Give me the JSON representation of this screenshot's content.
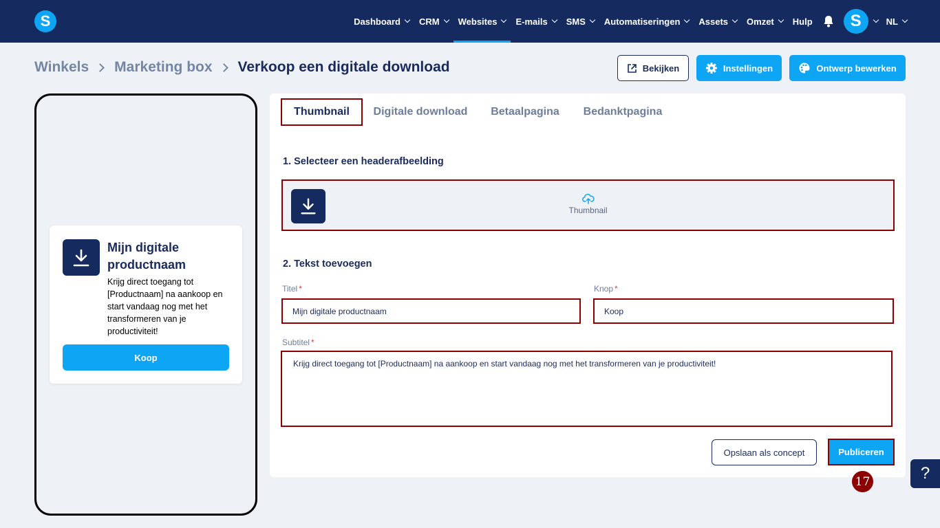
{
  "nav": {
    "logo_letter": "S",
    "items": [
      {
        "label": "Dashboard",
        "dropdown": true,
        "active": false
      },
      {
        "label": "CRM",
        "dropdown": true,
        "active": false
      },
      {
        "label": "Websites",
        "dropdown": true,
        "active": true
      },
      {
        "label": "E-mails",
        "dropdown": true,
        "active": false
      },
      {
        "label": "SMS",
        "dropdown": true,
        "active": false
      },
      {
        "label": "Automatiseringen",
        "dropdown": true,
        "active": false
      },
      {
        "label": "Assets",
        "dropdown": true,
        "active": false
      },
      {
        "label": "Omzet",
        "dropdown": true,
        "active": false
      },
      {
        "label": "Hulp",
        "dropdown": false,
        "active": false
      }
    ],
    "avatar_letter": "S",
    "language": "NL"
  },
  "breadcrumb": {
    "items": [
      "Winkels",
      "Marketing box"
    ],
    "current": "Verkoop een digitale download"
  },
  "header_buttons": {
    "view": "Bekijken",
    "settings": "Instellingen",
    "design": "Ontwerp bewerken"
  },
  "preview": {
    "title": "Mijn digitale productnaam",
    "subtitle": "Krijg direct toegang tot [Productnaam] na aankoop en start vandaag nog met het transformeren van je productiviteit!",
    "button": "Koop"
  },
  "tabs": [
    "Thumbnail",
    "Digitale download",
    "Betaalpagina",
    "Bedanktpagina"
  ],
  "active_tab": "Thumbnail",
  "section1": {
    "title": "1. Selecteer een headerafbeelding",
    "upload_label": "Thumbnail"
  },
  "section2": {
    "title": "2. Tekst toevoegen",
    "title_label": "Titel",
    "title_value": "Mijn digitale productnaam",
    "button_label": "Knop",
    "button_value": "Koop",
    "subtitle_label": "Subtitel",
    "subtitle_value": "Krijg direct toegang tot [Productnaam] na aankoop en start vandaag nog met het transformeren van je productiviteit!",
    "required_mark": "*"
  },
  "actions": {
    "save_draft": "Opslaan als concept",
    "publish": "Publiceren"
  },
  "step_badge": "17",
  "help": "?",
  "colors": {
    "nav_bg": "#152a5e",
    "accent": "#0ea5f5",
    "highlight": "#8b0000",
    "page_bg": "#eef2f7"
  }
}
